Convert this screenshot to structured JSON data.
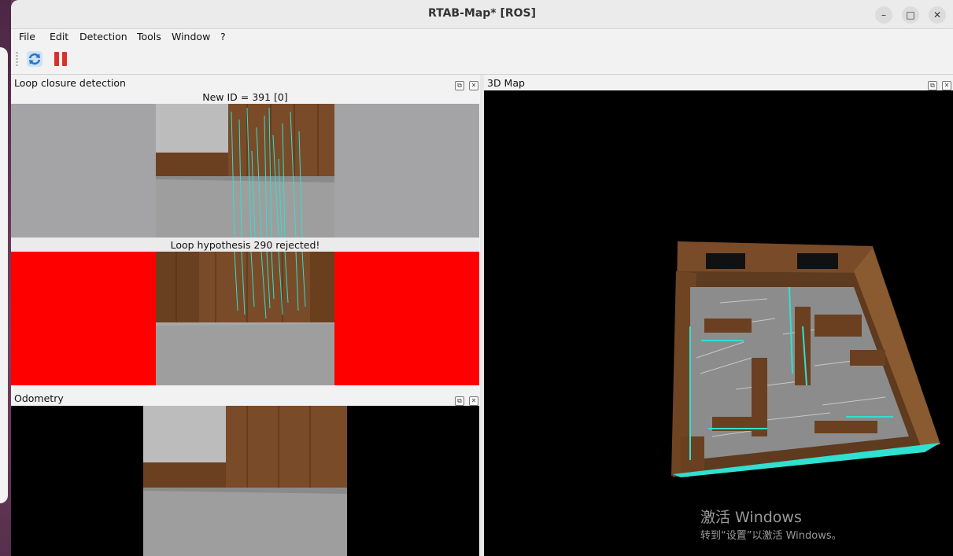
{
  "window": {
    "title": "RTAB-Map* [ROS]",
    "minimize_glyph": "–",
    "maximize_glyph": "□",
    "close_glyph": "✕"
  },
  "menu": {
    "items": [
      "File",
      "Edit",
      "Detection",
      "Tools",
      "Window",
      "?"
    ]
  },
  "toolbar": {
    "icons": [
      "refresh-icon",
      "pause-icon"
    ]
  },
  "loop_panel": {
    "title": "Loop closure detection",
    "new_id_caption": "New ID = 391 [0]",
    "hypothesis_caption": "Loop hypothesis 290 rejected!",
    "status_color": "#ff0000"
  },
  "odometry_panel": {
    "title": "Odometry"
  },
  "map_panel": {
    "title": "3D Map"
  },
  "dock_buttons": {
    "float_glyph": "⧉",
    "close_glyph": "✕"
  },
  "watermark": {
    "line1": "激活 Windows",
    "line2": "转到“设置”以激活 Windows。"
  },
  "colors": {
    "feature_match": "#30e0d0",
    "map_background": "#000000",
    "wood": "#7a4b28"
  }
}
